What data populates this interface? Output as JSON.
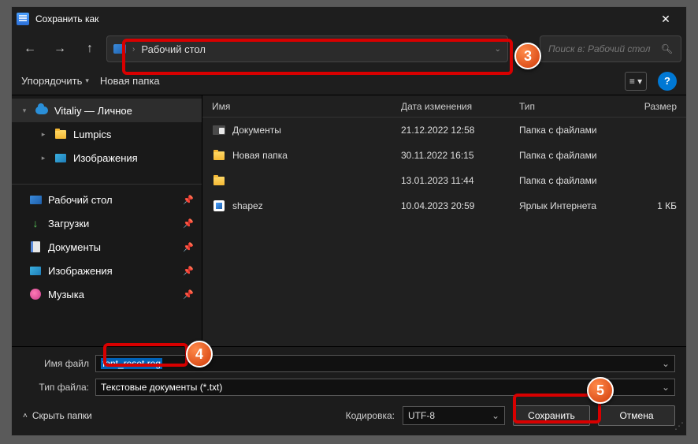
{
  "title": "Сохранить как",
  "breadcrumb": {
    "location": "Рабочий стол"
  },
  "search": {
    "placeholder": "Поиск в: Рабочий стол"
  },
  "toolbar": {
    "organize": "Упорядочить",
    "new_folder": "Новая папка"
  },
  "tree": {
    "personal": "Vitaliy — Личное",
    "lumpics": "Lumpics",
    "images": "Изображения",
    "quick": [
      {
        "label": "Рабочий стол"
      },
      {
        "label": "Загрузки"
      },
      {
        "label": "Документы"
      },
      {
        "label": "Изображения"
      },
      {
        "label": "Музыка"
      }
    ]
  },
  "columns": {
    "name": "Имя",
    "date": "Дата изменения",
    "type": "Тип",
    "size": "Размер"
  },
  "files": [
    {
      "name": "Документы",
      "date": "21.12.2022 12:58",
      "type": "Папка с файлами",
      "size": "",
      "icon": "docfolder"
    },
    {
      "name": "Новая папка",
      "date": "30.11.2022 16:15",
      "type": "Папка с файлами",
      "size": "",
      "icon": "folder"
    },
    {
      "name": "",
      "date": "13.01.2023 11:44",
      "type": "Папка с файлами",
      "size": "",
      "icon": "folder"
    },
    {
      "name": "shapez",
      "date": "10.04.2023 20:59",
      "type": "Ярлык Интернета",
      "size": "1 КБ",
      "icon": "shapez"
    }
  ],
  "fields": {
    "filename_label": "Имя файл",
    "filename_value": "font_reset.reg",
    "filetype_label": "Тип файла:",
    "filetype_value": "Текстовые документы (*.txt)"
  },
  "footer": {
    "hide_folders": "Скрыть папки",
    "encoding_label": "Кодировка:",
    "encoding_value": "UTF-8",
    "save": "Сохранить",
    "cancel": "Отмена"
  },
  "annotations": {
    "n3": "3",
    "n4": "4",
    "n5": "5"
  }
}
